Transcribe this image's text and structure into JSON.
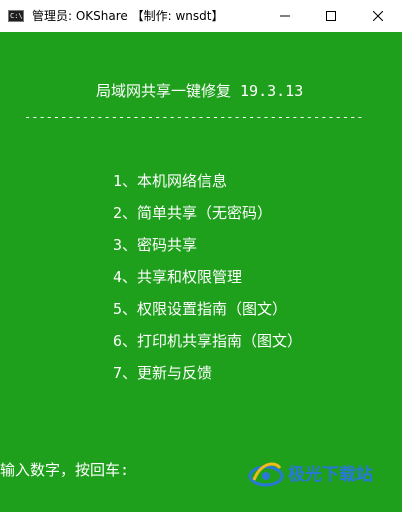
{
  "window": {
    "title": "管理员:  OKShare  【制作: wnsdt】",
    "app_icon_text": "C:\\"
  },
  "console": {
    "title": "局域网共享一键修复 19.3.13",
    "divider": "-----------------------------------------------",
    "menu": [
      "1、本机网络信息",
      "2、简单共享（无密码）",
      "3、密码共享",
      "4、共享和权限管理",
      "5、权限设置指南（图文）",
      "6、打印机共享指南（图文）",
      "7、更新与反馈"
    ],
    "prompt": "输入数字，按回车:"
  },
  "watermark": {
    "text": "极光下载站"
  },
  "colors": {
    "console_bg": "#1fa01c",
    "console_fg": "#ffffff",
    "watermark": "#2a78d6"
  }
}
